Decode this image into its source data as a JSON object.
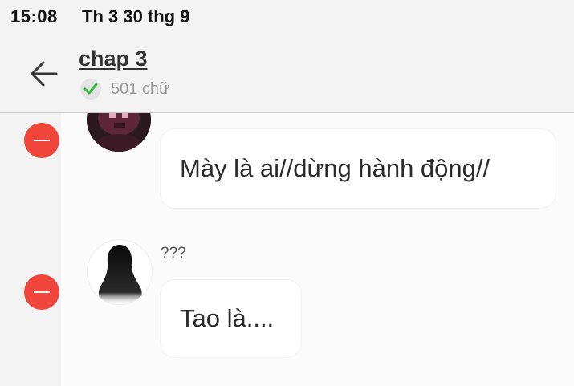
{
  "status_bar": {
    "time": "15:08",
    "date": "Th 3 30 thg 9"
  },
  "header": {
    "back_icon": "arrow-left-icon",
    "title": "chap 3",
    "status_icon": "checkmark-icon",
    "word_count": "501 chữ"
  },
  "messages": [
    {
      "speaker": "",
      "text": "Mày là ai//dừng hành động//",
      "avatar": "character-avatar",
      "remove_icon": "minus-circle-icon"
    },
    {
      "speaker": "???",
      "text": "Tao là....",
      "avatar": "silhouette-avatar",
      "remove_icon": "minus-circle-icon"
    }
  ],
  "colors": {
    "background": "#f3f3f3",
    "message_area": "#fbfbfb",
    "remove_red": "#f0453a",
    "check_green": "#2dbb3f"
  }
}
